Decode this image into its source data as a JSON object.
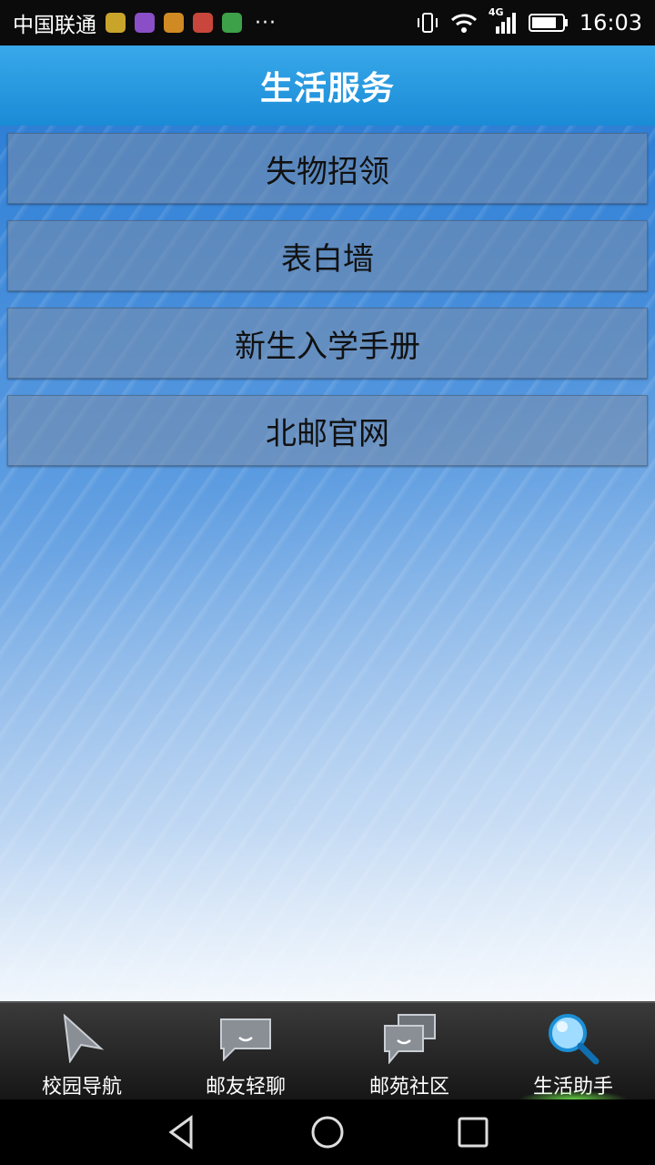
{
  "status_bar": {
    "carrier": "中国联通",
    "more": "···",
    "network": "4G",
    "time": "16:03"
  },
  "header": {
    "title": "生活服务"
  },
  "menu": {
    "items": [
      {
        "label": "失物招领"
      },
      {
        "label": "表白墙"
      },
      {
        "label": "新生入学手册"
      },
      {
        "label": "北邮官网"
      }
    ]
  },
  "tabs": [
    {
      "label": "校园导航",
      "icon": "navigation-arrow-icon"
    },
    {
      "label": "邮友轻聊",
      "icon": "chat-bubble-icon"
    },
    {
      "label": "邮苑社区",
      "icon": "community-bubbles-icon"
    },
    {
      "label": "生活助手",
      "icon": "search-icon",
      "active": true
    }
  ],
  "colors": {
    "header": "#1a8bd6",
    "tab_bar": "#1e1e1e",
    "active_glow": "#78ff50"
  }
}
